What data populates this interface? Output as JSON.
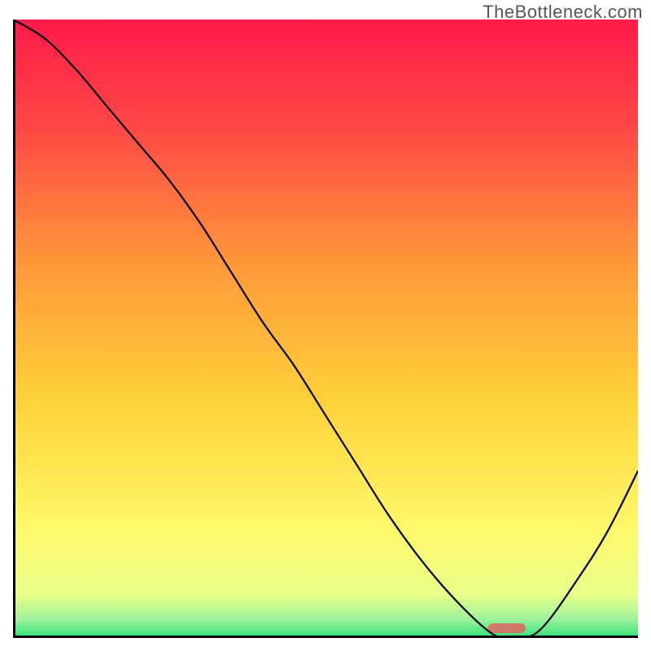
{
  "watermark": "TheBottleneck.com",
  "colors": {
    "gradient_top": "#ff1a4a",
    "gradient_mid1": "#ff6a3a",
    "gradient_mid2": "#ffd23a",
    "gradient_mid3": "#fff86a",
    "gradient_bottom": "#2fe07a",
    "curve": "#000000",
    "highlight": "#e06666"
  },
  "chart_data": {
    "type": "line",
    "title": "",
    "xlabel": "",
    "ylabel": "",
    "xlim": [
      0,
      100
    ],
    "ylim": [
      0,
      100
    ],
    "grid": false,
    "x": [
      0,
      5,
      10,
      15,
      20,
      25,
      30,
      35,
      40,
      45,
      50,
      55,
      60,
      65,
      70,
      75,
      78,
      80,
      82,
      85,
      90,
      95,
      100
    ],
    "values": [
      100,
      97,
      92,
      86,
      80,
      74,
      67,
      59,
      51,
      44,
      36,
      28,
      20,
      13,
      7,
      2,
      0,
      0,
      0,
      2,
      9,
      17,
      27
    ],
    "highlight_range_x": [
      76,
      82
    ],
    "annotations": [],
    "legend": {
      "visible": false
    }
  }
}
